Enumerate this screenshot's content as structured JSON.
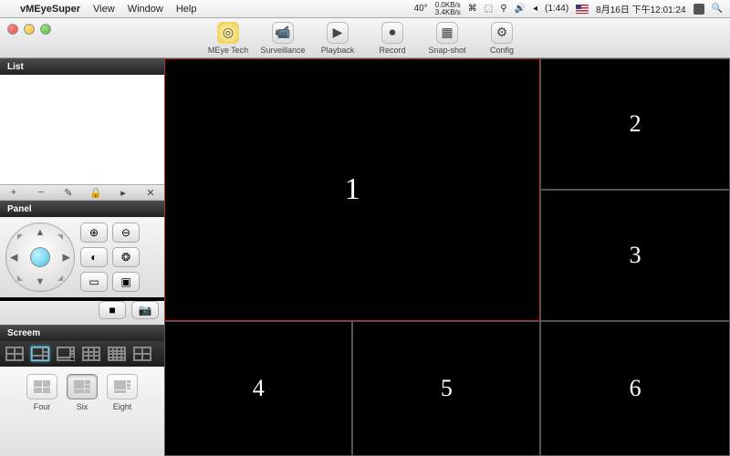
{
  "menubar": {
    "app": "vMEyeSuper",
    "items": [
      "View",
      "Window",
      "Help"
    ],
    "battery": "(1:44)",
    "temp": "40°",
    "net_up": "0.0KB/s",
    "net_down": "3.4KB/s",
    "date": "8月16日 下午12:01:24"
  },
  "toolbar": {
    "items": [
      {
        "id": "meye",
        "label": "MEye Tech",
        "glyph": "◎"
      },
      {
        "id": "surv",
        "label": "Surveillance",
        "glyph": "📹"
      },
      {
        "id": "play",
        "label": "Playback",
        "glyph": "▶"
      },
      {
        "id": "rec",
        "label": "Record",
        "glyph": "⏺"
      },
      {
        "id": "snap",
        "label": "Snap-shot",
        "glyph": "▦"
      },
      {
        "id": "conf",
        "label": "Config",
        "glyph": "⚙"
      }
    ]
  },
  "sidebar": {
    "list_header": "List",
    "list_tools": [
      "+",
      "−",
      "✎",
      "🔒",
      "▸",
      "✕"
    ],
    "panel_header": "Panel",
    "panel_btns": [
      {
        "id": "zoom-in",
        "g": "⊕"
      },
      {
        "id": "zoom-out",
        "g": "⊖"
      },
      {
        "id": "iris-open",
        "g": "◐"
      },
      {
        "id": "iris-close",
        "g": "❂"
      },
      {
        "id": "focus-near",
        "g": "▭"
      },
      {
        "id": "focus-far",
        "g": "▣"
      }
    ],
    "panel_row2": [
      {
        "id": "rec-btn",
        "g": "■"
      },
      {
        "id": "snap-btn",
        "g": "📷"
      }
    ],
    "screen_header": "Screem",
    "layouts": [
      {
        "id": "l4",
        "cls": "lay2"
      },
      {
        "id": "l6",
        "cls": "lay6",
        "active": true
      },
      {
        "id": "l8",
        "cls": "lay8"
      },
      {
        "id": "l9",
        "cls": "lay9"
      },
      {
        "id": "l16",
        "cls": "lay16"
      },
      {
        "id": "lcust",
        "cls": "lay2"
      }
    ],
    "footer": [
      {
        "id": "four",
        "label": "Four",
        "cls": "mini4"
      },
      {
        "id": "six",
        "label": "Six",
        "cls": "mini6",
        "sel": true
      },
      {
        "id": "eight",
        "label": "Eight",
        "cls": "mini8"
      }
    ]
  },
  "cells": [
    "1",
    "2",
    "3",
    "4",
    "5",
    "6"
  ],
  "selected_cell": 0
}
